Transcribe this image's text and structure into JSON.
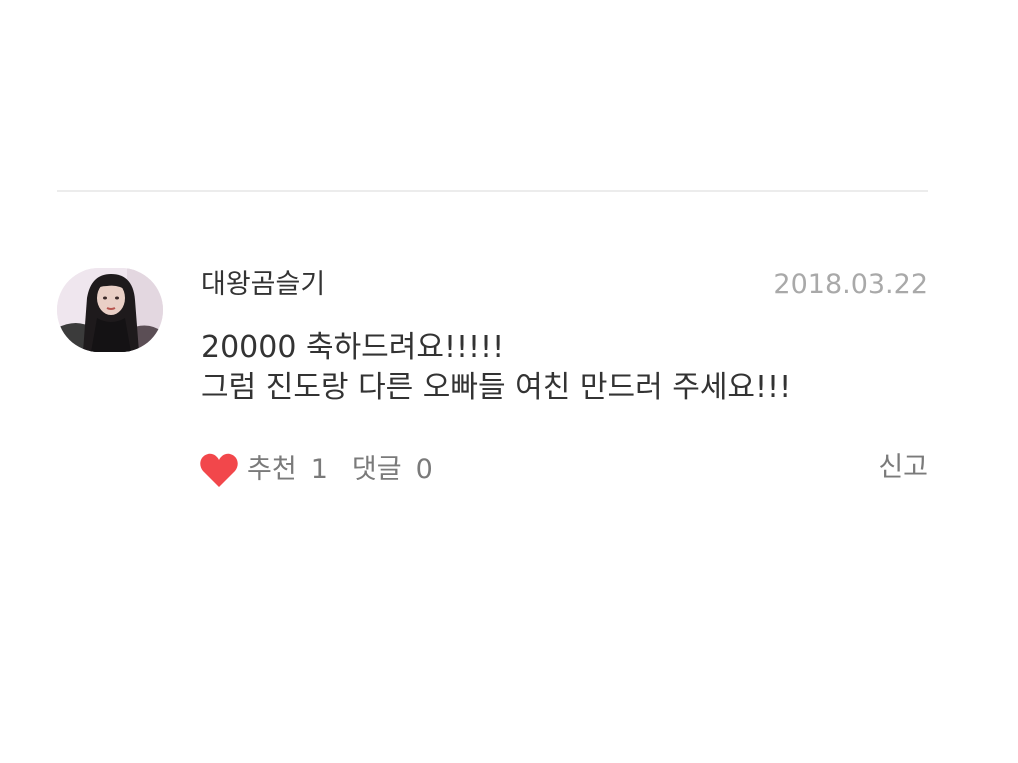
{
  "comment": {
    "username": "대왕곰슬기",
    "date": "2018.03.22",
    "body_lines": [
      "20000 축하드려요!!!!!",
      "그럼 진도랑 다른 오빠들 여친 만드러 주세요!!!"
    ],
    "recommend_label": "추천",
    "recommend_count": "1",
    "reply_label": "댓글",
    "reply_count": "0",
    "report_label": "신고",
    "heart_icon": "heart-icon",
    "heart_color": "#f2474b"
  }
}
